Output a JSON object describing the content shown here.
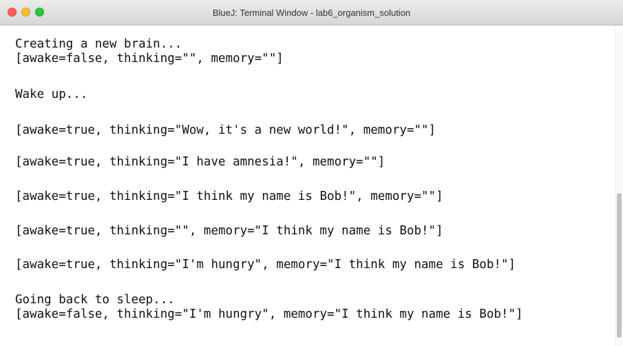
{
  "window": {
    "title": "BlueJ: Terminal Window - lab6_organism_solution"
  },
  "terminal": {
    "lines": [
      "Creating a new brain...",
      "[awake=false, thinking=\"\", memory=\"\"]",
      "Wake up...",
      "[awake=true, thinking=\"Wow, it's a new world!\", memory=\"\"]",
      "[awake=true, thinking=\"I have amnesia!\", memory=\"\"]",
      "[awake=true, thinking=\"I think my name is Bob!\", memory=\"\"]",
      "[awake=true, thinking=\"\", memory=\"I think my name is Bob!\"]",
      "[awake=true, thinking=\"I'm hungry\", memory=\"I think my name is Bob!\"]",
      "Going back to sleep...",
      "[awake=false, thinking=\"I'm hungry\", memory=\"I think my name is Bob!\"]"
    ]
  },
  "colors": {
    "close_button": "#fe5f57",
    "minimize_button": "#febc2e",
    "zoom_button": "#28c840"
  }
}
